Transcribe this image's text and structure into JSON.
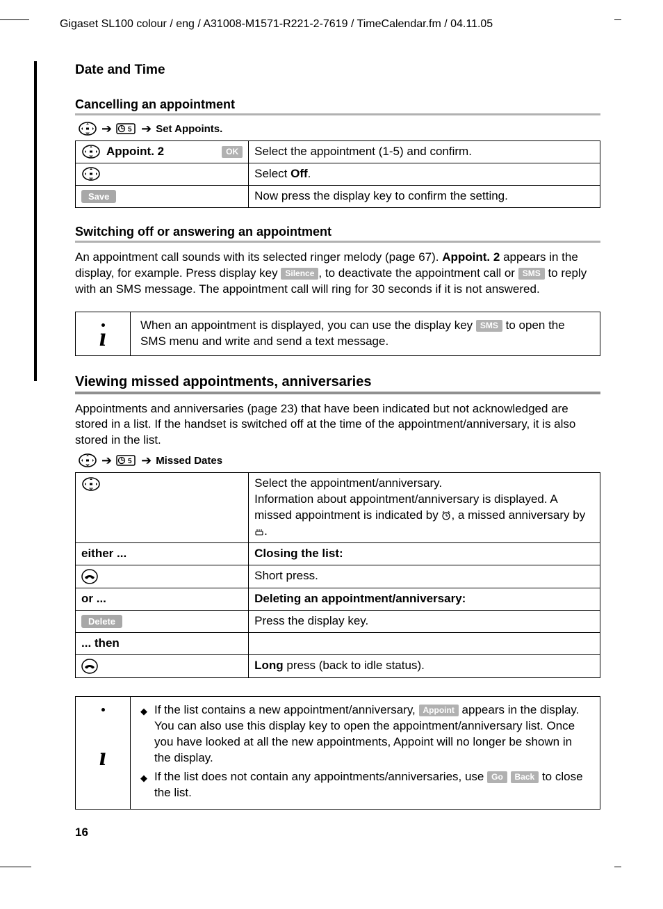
{
  "header": "Gigaset SL100 colour / eng / A31008-M1571-R221-2-7619 / TimeCalendar.fm / 04.11.05",
  "section_title": "Date and Time",
  "cancel": {
    "title": "Cancelling an appointment",
    "nav_label": "Set Appoints.",
    "row1_left": "Appoint. 2",
    "row1_btn": "OK",
    "row1_right": "Select the appointment (1-5) and confirm.",
    "row2_right_a": "Select ",
    "row2_right_b": "Off",
    "row2_right_c": ".",
    "row3_btn": "Save",
    "row3_right": "Now press the display key to confirm the setting."
  },
  "switching": {
    "title": "Switching off or answering an appointment",
    "para_a": "An appointment call sounds with its selected ringer melody (page 67). ",
    "para_b": "Appoint. 2",
    "para_c": " appears in the display, for example. Press display key ",
    "pill1": "Silence",
    "para_d": ", to deactivate the appointment call or ",
    "pill2": "SMS",
    "para_e": " to reply with an SMS message. The appointment call will ring for 30 seconds if it is not answered.",
    "note_a": "When an appointment is displayed, you can use the display key ",
    "note_pill": "SMS",
    "note_b": " to open the SMS menu and write and send a text message."
  },
  "viewing": {
    "title": "Viewing missed appointments, anniversaries",
    "intro": "Appointments and anniversaries (page 23) that have been indicated but not acknowledged are stored in a list. If the handset is switched off at the time of the appointment/anniversary, it is also stored in the list.",
    "nav_label": "Missed Dates",
    "r1a": "Select the appointment/anniversary.",
    "r1b_a": "Information about appointment/anniversary is displayed. A missed appointment is indicated by ",
    "r1b_b": ", a missed anniversary by ",
    "r1b_c": ".",
    "either": "either ...",
    "closing": "Closing the list:",
    "short": "Short press.",
    "or": "or ...",
    "deleting": "Deleting an appointment/anniversary:",
    "del_btn": "Delete",
    "del_right": "Press the display key.",
    "then": "... then",
    "long_a": "Long",
    "long_b": " press (back to idle status)."
  },
  "bottom_note": {
    "li1_a": "If the list contains a new appointment/anniversary, ",
    "li1_pill": "Appoint",
    "li1_b": " appears in the display. You can also use this display key to open the appointment/anniversary list. Once you have looked at all the new appointments, Appoint will no longer be shown in the display.",
    "li2_a": "If the list does not contain any appointments/anniversaries, use ",
    "li2_pill1": "Go",
    "li2_pill2": "Back",
    "li2_b": " to close the list."
  },
  "page_number": "16"
}
